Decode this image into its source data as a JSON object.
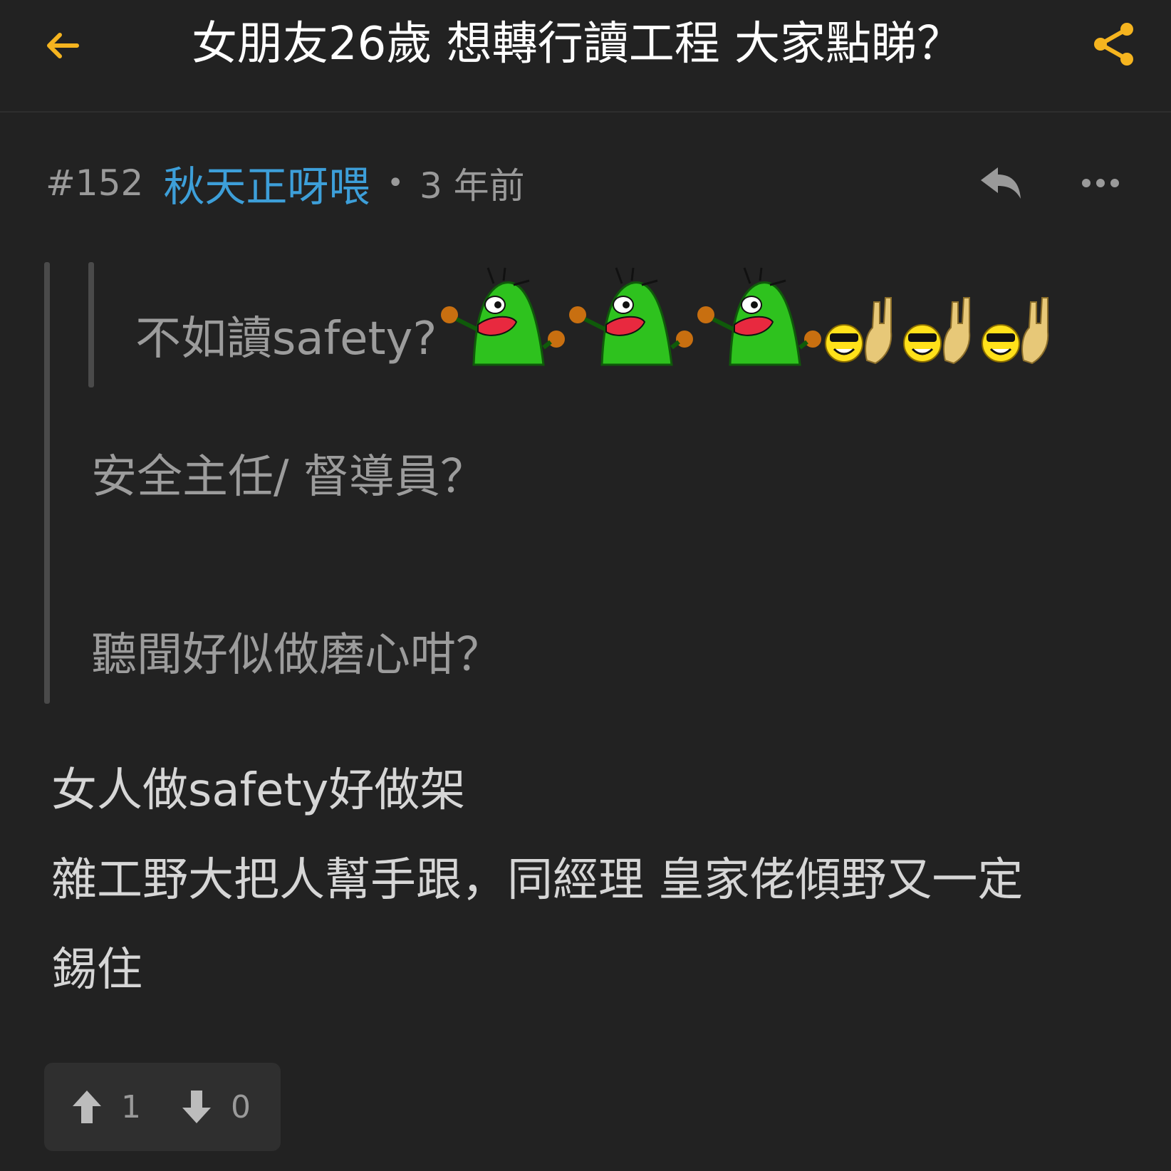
{
  "header": {
    "title": "女朋友26歲 想轉行讀工程 大家點睇？",
    "accent_color": "#f5b41f",
    "back_icon": "arrow-left-icon",
    "share_icon": "share-icon"
  },
  "post": {
    "number": "#152",
    "author": "秋天正呀喂",
    "separator": "•",
    "time": "3 年前",
    "author_color": "#3d9fd9",
    "reply_icon": "reply-icon",
    "more_icon": "more-horizontal-icon"
  },
  "quote": {
    "nested_text": "不如讀safety?",
    "stickers": [
      "green-monster-sticker",
      "green-monster-sticker",
      "green-monster-sticker",
      "cool-face-rock-sticker",
      "cool-face-rock-sticker",
      "cool-face-rock-sticker"
    ],
    "lines": [
      "安全主任/ 督導員？",
      "聽聞好似做磨心咁？"
    ]
  },
  "body": {
    "lines": [
      "女人做safety好做架",
      "雜工野大把人幫手跟，同經理 皇家佬傾野又一定",
      "錫住"
    ]
  },
  "votes": {
    "up_count": "1",
    "down_count": "0",
    "up_icon": "arrow-up-icon",
    "down_icon": "arrow-down-icon"
  }
}
